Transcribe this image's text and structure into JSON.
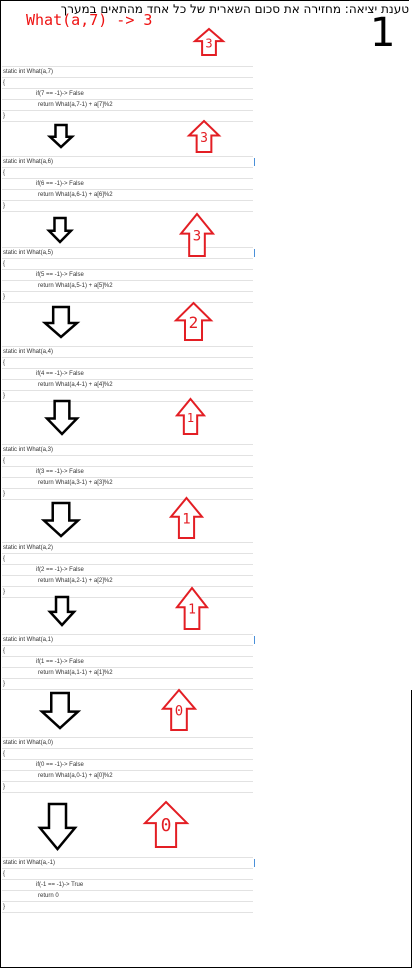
{
  "header": {
    "description_he": "טענת יציאה: מחזירה את סכום השארית של כל אחד מהתאים במערך",
    "call": "What(a,7) -> 3",
    "slide_number": "1"
  },
  "code_blocks": [
    {
      "signature": "static int What(a,7)",
      "open": "{",
      "condition": "if(7 == -1)-> False",
      "return_line": "return What(a,7-1) + a[7]%2",
      "close": "}"
    },
    {
      "signature": "static int What(a,6)",
      "open": "{",
      "condition": "if(6 == -1)-> False",
      "return_line": "return What(a,6-1) + a[6]%2",
      "close": "}"
    },
    {
      "signature": "static int What(a,5)",
      "open": "{",
      "condition": "if(5 == -1)-> False",
      "return_line": "return What(a,5-1) + a[5]%2",
      "close": "}"
    },
    {
      "signature": "static int What(a,4)",
      "open": "{",
      "condition": "if(4 == -1)-> False",
      "return_line": "return What(a,4-1) + a[4]%2",
      "close": "}"
    },
    {
      "signature": "static int What(a,3)",
      "open": "{",
      "condition": "if(3 == -1)-> False",
      "return_line": "return What(a,3-1) + a[3]%2",
      "close": "}"
    },
    {
      "signature": "static int What(a,2)",
      "open": "{",
      "condition": "if(2 == -1)-> False",
      "return_line": "return What(a,2-1) + a[2]%2",
      "close": "}"
    },
    {
      "signature": "static int What(a,1)",
      "open": "{",
      "condition": "if(1 == -1)-> False",
      "return_line": "return What(a,1-1) + a[1]%2",
      "close": "}"
    },
    {
      "signature": "static int What(a,0)",
      "open": "{",
      "condition": "if(0 == -1)-> False",
      "return_line": "return What(a,0-1) + a[0]%2",
      "close": "}"
    },
    {
      "signature": "static int What(a,-1)",
      "open": "{",
      "condition": "if(-1 == -1)-> True",
      "return_line": "return 0",
      "close": "}"
    }
  ],
  "up_arrows": [
    {
      "value": "3"
    },
    {
      "value": "3"
    },
    {
      "value": "3"
    },
    {
      "value": "2"
    },
    {
      "value": "1"
    },
    {
      "value": "1"
    },
    {
      "value": "1"
    },
    {
      "value": "0"
    },
    {
      "value": "0"
    }
  ],
  "down_arrow_count": 8,
  "colors": {
    "up_arrow": "#e31e24",
    "down_arrow": "#000000",
    "call_text": "#ee1111",
    "code_text": "#333333",
    "grid_line": "#e2e2e2",
    "cursor": "#4a90d9"
  }
}
